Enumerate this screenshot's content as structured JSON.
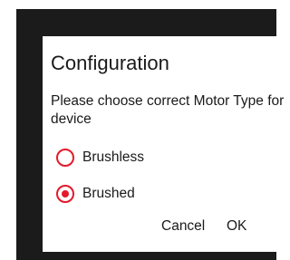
{
  "dialog": {
    "title": "Configuration",
    "message": "Please choose correct Motor Type for device",
    "options": [
      {
        "label": "Brushless",
        "selected": false
      },
      {
        "label": "Brushed",
        "selected": true
      }
    ],
    "cancel_label": "Cancel",
    "ok_label": "OK"
  },
  "colors": {
    "accent": "#e4192b",
    "backdrop": "#1b1b1b",
    "dialog_bg": "#ffffff",
    "text": "#1a1a1a"
  }
}
